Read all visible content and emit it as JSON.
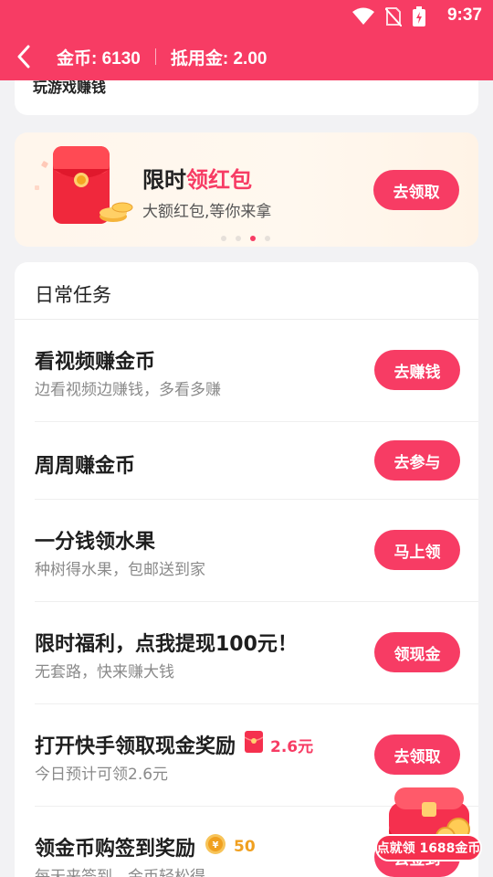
{
  "status_bar": {
    "time": "9:37"
  },
  "header": {
    "coins_label": "金币: 6130",
    "deduct_label": "抵用金: 2.00"
  },
  "top_card": {
    "text": "玩游戏赚钱"
  },
  "banner": {
    "title_prefix": "限时",
    "title_highlight": "领红包",
    "subtitle": "大额红包,等你来拿",
    "button": "去领取",
    "pages": 4,
    "active_page": 2
  },
  "tasks": {
    "section_title": "日常任务",
    "items": [
      {
        "title": "看视频赚金币",
        "desc": "边看视频边赚钱，多看多赚",
        "button": "去赚钱"
      },
      {
        "title": "周周赚金币",
        "desc": "",
        "button": "去参与"
      },
      {
        "title": "一分钱领水果",
        "desc": "种树得水果，包邮送到家",
        "button": "马上领"
      },
      {
        "title": "限时福利，点我提现100元！",
        "desc": "无套路，快来赚大钱",
        "button": "领现金"
      },
      {
        "title": "打开快手领取现金奖励",
        "reward": "2.6元",
        "reward_icon": "red-envelope-icon",
        "desc": "今日预计可领2.6元",
        "button": "去领取"
      },
      {
        "title": "领金币购签到奖励",
        "reward": "50",
        "reward_icon": "gold-coin-icon",
        "desc": "每天来签到，金币轻松得",
        "button": "去签到"
      }
    ]
  },
  "floating": {
    "label": "点就领 1688金币"
  },
  "colors": {
    "accent": "#f73c64",
    "gold": "#f0a020"
  }
}
